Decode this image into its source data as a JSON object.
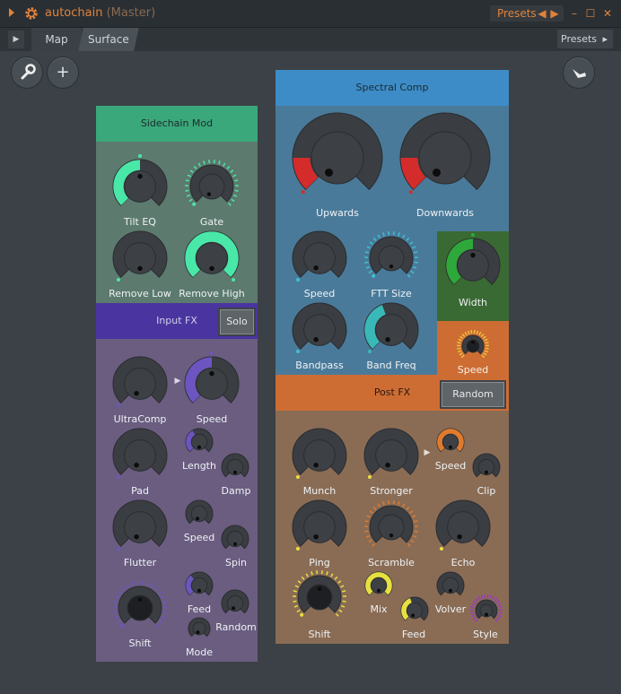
{
  "window": {
    "title": "autochain",
    "subtitle": "(Master)",
    "presets_label": "Presets"
  },
  "tabs": {
    "map": "Map",
    "surface": "Surface",
    "presets": "Presets"
  },
  "sidechain": {
    "header": "Sidechain Mod",
    "knobs": {
      "tilt_eq": "Tilt EQ",
      "gate": "Gate",
      "remove_low": "Remove Low",
      "remove_high": "Remove High"
    }
  },
  "input_fx": {
    "header": "Input FX",
    "solo": "Solo",
    "knobs": {
      "ultracomp": "UltraComp",
      "speed1": "Speed",
      "length": "Length",
      "pad": "Pad",
      "damp": "Damp",
      "speed2": "Speed",
      "flutter": "Flutter",
      "spin": "Spin",
      "feed": "Feed",
      "shift": "Shift",
      "random": "Random",
      "mode": "Mode"
    }
  },
  "spectral": {
    "header": "Spectral Comp",
    "knobs": {
      "upwards": "Upwards",
      "downwards": "Downwards",
      "speed": "Speed",
      "fft_size": "FTT Size",
      "width": "Width",
      "bandpass": "Bandpass",
      "band_freq": "Band Freq",
      "speed2": "Speed"
    }
  },
  "post_fx": {
    "header": "Post FX",
    "random": "Random",
    "knobs": {
      "munch": "Munch",
      "stronger": "Stronger",
      "speed": "Speed",
      "clip": "Clip",
      "ping": "Ping",
      "scramble": "Scramble",
      "echo": "Echo",
      "shift": "Shift",
      "mix": "Mix",
      "volver": "Volver",
      "feed": "Feed",
      "style": "Style"
    }
  },
  "colors": {
    "sidechain": "#5c7a6e",
    "sidechain_header": "#3aa87a",
    "input_fx": "#6a5d80",
    "input_fx_header": "#4a35a0",
    "spectral": "#4a7a9a",
    "spectral_header": "#3d8cc8",
    "post_fx": "#8a6c55",
    "post_fx_header": "#cd6d33",
    "width_bg": "#3a6a33",
    "accent_green": "#49e8a8",
    "accent_purple": "#6c55c0",
    "accent_red": "#d42b2b",
    "accent_orange": "#e07b2e",
    "accent_yellow": "#e6e040"
  }
}
